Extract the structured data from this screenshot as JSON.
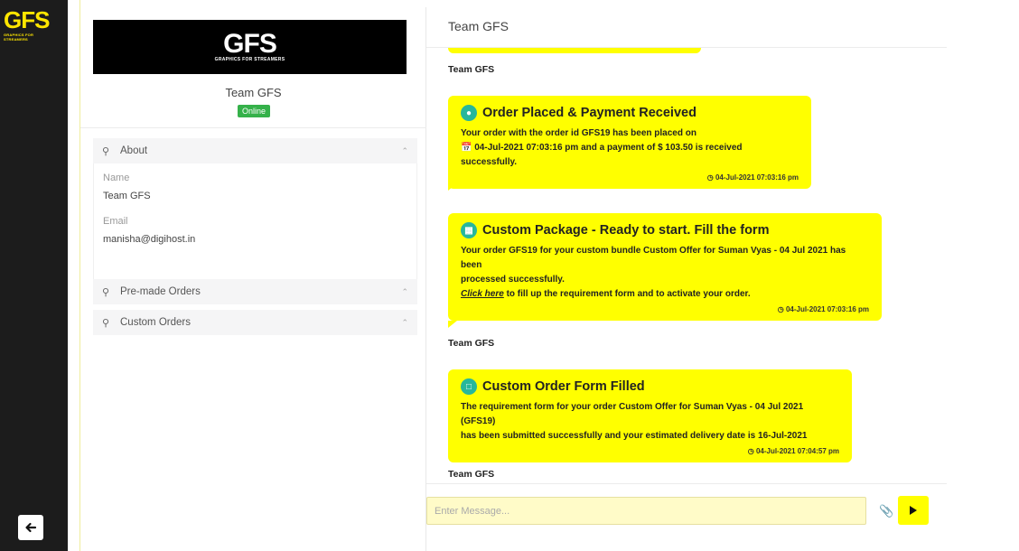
{
  "rail": {
    "logo_text": "GFS",
    "logo_tagline": "GRAPHICS FOR STREAMERS",
    "back_icon": "arrow-left-icon"
  },
  "profile": {
    "banner_text": "GFS",
    "banner_tagline": "GRAPHICS FOR STREAMERS",
    "name": "Team GFS",
    "status": "Online"
  },
  "about": {
    "label": "About",
    "name_label": "Name",
    "name_value": "Team GFS",
    "email_label": "Email",
    "email_value": "manisha@digihost.in"
  },
  "sections": {
    "premade": "Pre-made Orders",
    "custom": "Custom Orders"
  },
  "chat": {
    "title": "Team GFS",
    "sender": "Team GFS",
    "messages": [
      {
        "title": "Order Placed & Payment Received",
        "line1": "Your order with the order id GFS19 has been placed on",
        "line2": "04-Jul-2021 07:03:16 pm and a payment of $ 103.50 is received successfully.",
        "time": "04-Jul-2021 07:03:16 pm"
      },
      {
        "title": "Custom Package - Ready to start. Fill the form",
        "line1": "Your order GFS19 for your custom bundle Custom Offer for Suman Vyas - 04 Jul 2021 has been",
        "line2": "processed successfully.",
        "link": "Click here",
        "line3": " to fill up the requirement form and to activate your order.",
        "time": "04-Jul-2021 07:03:16 pm"
      },
      {
        "title": "Custom Order Form Filled",
        "line1": "The requirement form for your order Custom Offer for Suman Vyas - 04 Jul 2021 (GFS19)",
        "line2": "has been submitted successfully and your estimated delivery date is 16-Jul-2021",
        "time": "04-Jul-2021 07:04:57 pm"
      }
    ],
    "input_placeholder": "Enter Message..."
  },
  "colors": {
    "accent": "#ffff00",
    "online": "#35b14a",
    "rail": "#1c1c1c",
    "icon_teal": "#27b79b"
  }
}
